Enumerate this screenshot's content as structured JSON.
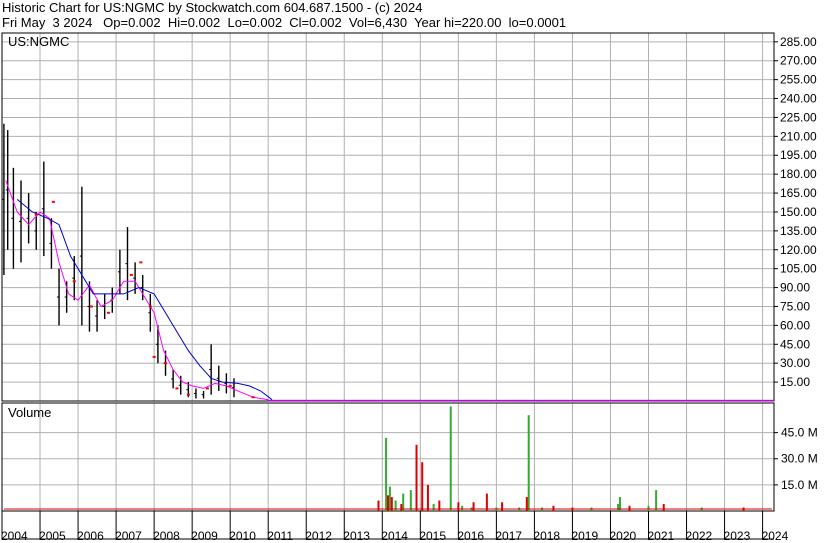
{
  "header": {
    "line1": "Historic Chart for US:NGMC by Stockwatch.com 604.687.1500 - (c) 2024",
    "line2": "Fri May  3 2024   Op=0.002  Hi=0.002  Lo=0.002  Cl=0.002  Vol=6,430  Year hi=220.00  lo=0.0001"
  },
  "colors": {
    "price_bar": "#000000",
    "ma_short": "#ff00ff",
    "ma_long": "#0000cc",
    "red_dot": "#ff0000",
    "volume_up": "#33aa33",
    "volume_down": "#dd0000",
    "grid": "#b0b0b0"
  },
  "chart_data": [
    {
      "type": "line",
      "panel": "price",
      "title": "US:NGMC",
      "ylim": [
        0,
        292
      ],
      "y_ticks": [
        "285.00",
        "270.00",
        "255.00",
        "240.00",
        "225.00",
        "210.00",
        "195.00",
        "180.00",
        "165.00",
        "150.00",
        "135.00",
        "120.00",
        "105.00",
        "90.00",
        "75.00",
        "60.00",
        "45.00",
        "30.00",
        "15.00"
      ],
      "x_ticks": [
        "2004",
        "2005",
        "2006",
        "2007",
        "2008",
        "2009",
        "2010",
        "2011",
        "2012",
        "2013",
        "2014",
        "2015",
        "2016",
        "2017",
        "2018",
        "2019",
        "2020",
        "2021",
        "2022",
        "2023",
        "2024"
      ],
      "ohlc_sample": [
        {
          "t": 2004.05,
          "hi": 220,
          "lo": 100
        },
        {
          "t": 2004.15,
          "hi": 215,
          "lo": 120
        },
        {
          "t": 2004.3,
          "hi": 185,
          "lo": 105
        },
        {
          "t": 2004.5,
          "hi": 175,
          "lo": 110
        },
        {
          "t": 2004.7,
          "hi": 165,
          "lo": 125
        },
        {
          "t": 2004.9,
          "hi": 150,
          "lo": 120
        },
        {
          "t": 2005.1,
          "hi": 190,
          "lo": 115
        },
        {
          "t": 2005.3,
          "hi": 145,
          "lo": 105
        },
        {
          "t": 2005.5,
          "hi": 105,
          "lo": 60
        },
        {
          "t": 2005.7,
          "hi": 95,
          "lo": 70
        },
        {
          "t": 2005.9,
          "hi": 115,
          "lo": 80
        },
        {
          "t": 2006.1,
          "hi": 170,
          "lo": 60
        },
        {
          "t": 2006.3,
          "hi": 95,
          "lo": 55
        },
        {
          "t": 2006.5,
          "hi": 80,
          "lo": 55
        },
        {
          "t": 2006.7,
          "hi": 85,
          "lo": 65
        },
        {
          "t": 2006.9,
          "hi": 90,
          "lo": 70
        },
        {
          "t": 2007.1,
          "hi": 120,
          "lo": 85
        },
        {
          "t": 2007.3,
          "hi": 138,
          "lo": 80
        },
        {
          "t": 2007.5,
          "hi": 110,
          "lo": 85
        },
        {
          "t": 2007.7,
          "hi": 100,
          "lo": 80
        },
        {
          "t": 2007.9,
          "hi": 85,
          "lo": 55
        },
        {
          "t": 2008.1,
          "hi": 60,
          "lo": 30
        },
        {
          "t": 2008.3,
          "hi": 40,
          "lo": 20
        },
        {
          "t": 2008.5,
          "hi": 25,
          "lo": 10
        },
        {
          "t": 2008.7,
          "hi": 20,
          "lo": 5
        },
        {
          "t": 2008.9,
          "hi": 15,
          "lo": 3
        },
        {
          "t": 2009.1,
          "hi": 10,
          "lo": 2
        },
        {
          "t": 2009.3,
          "hi": 8,
          "lo": 2
        },
        {
          "t": 2009.5,
          "hi": 45,
          "lo": 5
        },
        {
          "t": 2009.7,
          "hi": 28,
          "lo": 8
        },
        {
          "t": 2009.9,
          "hi": 22,
          "lo": 6
        },
        {
          "t": 2010.1,
          "hi": 18,
          "lo": 3
        }
      ],
      "series": [
        {
          "color": "#ff00ff",
          "points": [
            [
              2004.1,
              175
            ],
            [
              2004.4,
              150
            ],
            [
              2004.7,
              140
            ],
            [
              2005.0,
              150
            ],
            [
              2005.25,
              145
            ],
            [
              2005.5,
              110
            ],
            [
              2005.75,
              85
            ],
            [
              2006.0,
              80
            ],
            [
              2006.3,
              92
            ],
            [
              2006.6,
              75
            ],
            [
              2006.9,
              80
            ],
            [
              2007.2,
              95
            ],
            [
              2007.5,
              95
            ],
            [
              2007.8,
              80
            ],
            [
              2008.0,
              70
            ],
            [
              2008.25,
              40
            ],
            [
              2008.5,
              25
            ],
            [
              2008.75,
              15
            ],
            [
              2009.0,
              12
            ],
            [
              2009.3,
              10
            ],
            [
              2009.6,
              14
            ],
            [
              2009.9,
              12
            ],
            [
              2010.2,
              8
            ],
            [
              2010.6,
              3
            ],
            [
              2011.0,
              1
            ]
          ]
        },
        {
          "color": "#0000cc",
          "points": [
            [
              2004.4,
              160
            ],
            [
              2004.8,
              150
            ],
            [
              2005.2,
              145
            ],
            [
              2005.5,
              140
            ],
            [
              2005.8,
              115
            ],
            [
              2006.1,
              100
            ],
            [
              2006.4,
              85
            ],
            [
              2006.8,
              85
            ],
            [
              2007.2,
              85
            ],
            [
              2007.6,
              90
            ],
            [
              2008.0,
              85
            ],
            [
              2008.3,
              70
            ],
            [
              2008.6,
              55
            ],
            [
              2008.9,
              40
            ],
            [
              2009.2,
              28
            ],
            [
              2009.5,
              18
            ],
            [
              2009.8,
              15
            ],
            [
              2010.2,
              14
            ],
            [
              2010.5,
              12
            ],
            [
              2010.8,
              8
            ],
            [
              2011.1,
              1
            ]
          ]
        },
        {
          "color": "#ff0000",
          "points": [
            [
              2004.9,
              148
            ],
            [
              2005.35,
              158
            ],
            [
              2005.9,
              95
            ],
            [
              2006.35,
              75
            ],
            [
              2006.8,
              70
            ],
            [
              2007.4,
              100
            ],
            [
              2007.65,
              110
            ],
            [
              2007.9,
              75
            ],
            [
              2008.0,
              35
            ],
            [
              2008.3,
              30
            ],
            [
              2008.6,
              10
            ],
            [
              2008.9,
              5
            ],
            [
              2009.4,
              10
            ],
            [
              2010.0,
              12
            ],
            [
              2010.6,
              3
            ]
          ]
        }
      ]
    },
    {
      "type": "bar",
      "panel": "volume",
      "title": "Volume",
      "ylim": [
        0,
        62
      ],
      "y_ticks": [
        "45.0 M",
        "30.0 M",
        "15.0 M"
      ],
      "bars_up": [
        [
          2014.1,
          42
        ],
        [
          2014.2,
          14
        ],
        [
          2014.35,
          6
        ],
        [
          2014.55,
          10
        ],
        [
          2014.75,
          12
        ],
        [
          2015.35,
          4
        ],
        [
          2015.8,
          60
        ],
        [
          2016.1,
          3
        ],
        [
          2016.35,
          2
        ],
        [
          2017.0,
          2
        ],
        [
          2017.6,
          2
        ],
        [
          2017.85,
          55
        ],
        [
          2018.2,
          2
        ],
        [
          2019.5,
          2
        ],
        [
          2020.2,
          4
        ],
        [
          2020.25,
          8
        ],
        [
          2021.2,
          12
        ],
        [
          2021.0,
          3
        ],
        [
          2022.4,
          2
        ]
      ],
      "bars_down": [
        [
          2013.9,
          6
        ],
        [
          2014.15,
          9
        ],
        [
          2014.25,
          8
        ],
        [
          2014.5,
          4
        ],
        [
          2014.9,
          38
        ],
        [
          2015.05,
          28
        ],
        [
          2015.2,
          15
        ],
        [
          2015.5,
          6
        ],
        [
          2016.0,
          5
        ],
        [
          2016.4,
          5
        ],
        [
          2016.75,
          10
        ],
        [
          2017.15,
          5
        ],
        [
          2017.8,
          8
        ],
        [
          2018.5,
          3
        ],
        [
          2019.0,
          2
        ],
        [
          2020.5,
          3
        ],
        [
          2021.4,
          4
        ],
        [
          2023.5,
          2
        ]
      ]
    }
  ]
}
